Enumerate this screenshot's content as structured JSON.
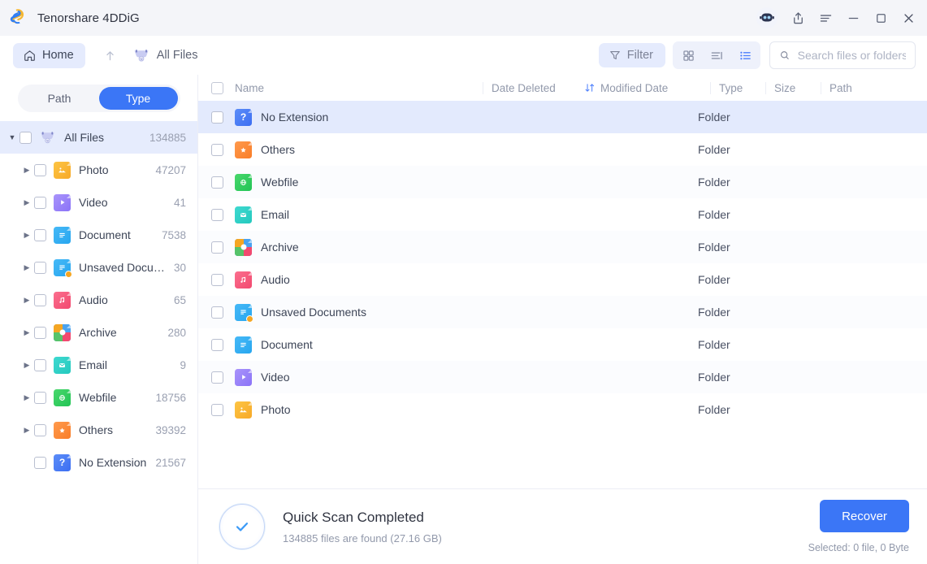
{
  "titlebar": {
    "app_name": "Tenorshare 4DDiG",
    "logo_icon": "4ddig-logo-icon",
    "buttons": [
      {
        "name": "ai-assistant-icon",
        "label": "AI"
      },
      {
        "name": "share-icon",
        "label": "Share"
      },
      {
        "name": "menu-icon",
        "label": "Menu"
      },
      {
        "name": "minimize-icon",
        "label": "Minimize"
      },
      {
        "name": "maximize-icon",
        "label": "Maximize"
      },
      {
        "name": "close-icon",
        "label": "Close"
      }
    ]
  },
  "toolbar": {
    "home_label": "Home",
    "home_icon": "home-icon",
    "up_icon": "arrow-up-icon",
    "breadcrumb_label": "All Files",
    "breadcrumb_icon": "all-files-icon",
    "filter_label": "Filter",
    "filter_icon": "funnel-icon",
    "view_grid_icon": "grid-view-icon",
    "view_detail_icon": "detail-view-icon",
    "view_list_icon": "list-view-icon",
    "active_view": "list",
    "search_icon": "search-icon",
    "search_value": "",
    "search_placeholder": "Search files or folders"
  },
  "sidebar": {
    "tabs": [
      {
        "label": "Path",
        "active": false
      },
      {
        "label": "Type",
        "active": true
      }
    ],
    "root": {
      "label": "All Files",
      "count": "134885",
      "icon": "all-files-icon",
      "selected": true
    },
    "items": [
      {
        "label": "Photo",
        "count": "47207",
        "icon": "photo-icon",
        "color": "#f9b game",
        "expandable": true
      },
      {
        "label": "Video",
        "count": "41",
        "icon": "video-icon",
        "expandable": true
      },
      {
        "label": "Document",
        "count": "7538",
        "icon": "document-icon",
        "expandable": true
      },
      {
        "label": "Unsaved Docum...",
        "count": "30",
        "icon": "unsaved-document-icon",
        "expandable": true
      },
      {
        "label": "Audio",
        "count": "65",
        "icon": "audio-icon",
        "expandable": true
      },
      {
        "label": "Archive",
        "count": "280",
        "icon": "archive-icon",
        "expandable": true
      },
      {
        "label": "Email",
        "count": "9",
        "icon": "email-icon",
        "expandable": true
      },
      {
        "label": "Webfile",
        "count": "18756",
        "icon": "webfile-icon",
        "expandable": true
      },
      {
        "label": "Others",
        "count": "39392",
        "icon": "others-icon",
        "expandable": true
      },
      {
        "label": "No Extension",
        "count": "21567",
        "icon": "no-extension-icon",
        "expandable": false
      }
    ]
  },
  "table": {
    "columns": [
      {
        "label": "Name",
        "key": "name"
      },
      {
        "label": "Date Deleted",
        "key": "date_deleted"
      },
      {
        "label": "Modified Date",
        "key": "modified_date",
        "sort_icon": "sort-icon"
      },
      {
        "label": "Type",
        "key": "type"
      },
      {
        "label": "Size",
        "key": "size"
      },
      {
        "label": "Path",
        "key": "path"
      }
    ],
    "rows": [
      {
        "name": "No Extension",
        "icon": "no-extension-icon",
        "date_deleted": "",
        "modified_date": "",
        "type": "Folder",
        "size": "",
        "path": "",
        "selected": true
      },
      {
        "name": "Others",
        "icon": "others-icon",
        "date_deleted": "",
        "modified_date": "",
        "type": "Folder",
        "size": "",
        "path": ""
      },
      {
        "name": "Webfile",
        "icon": "webfile-icon",
        "date_deleted": "",
        "modified_date": "",
        "type": "Folder",
        "size": "",
        "path": ""
      },
      {
        "name": "Email",
        "icon": "email-icon",
        "date_deleted": "",
        "modified_date": "",
        "type": "Folder",
        "size": "",
        "path": ""
      },
      {
        "name": "Archive",
        "icon": "archive-icon",
        "date_deleted": "",
        "modified_date": "",
        "type": "Folder",
        "size": "",
        "path": ""
      },
      {
        "name": "Audio",
        "icon": "audio-icon",
        "date_deleted": "",
        "modified_date": "",
        "type": "Folder",
        "size": "",
        "path": ""
      },
      {
        "name": "Unsaved Documents",
        "icon": "unsaved-document-icon",
        "date_deleted": "",
        "modified_date": "",
        "type": "Folder",
        "size": "",
        "path": ""
      },
      {
        "name": "Document",
        "icon": "document-icon",
        "date_deleted": "",
        "modified_date": "",
        "type": "Folder",
        "size": "",
        "path": ""
      },
      {
        "name": "Video",
        "icon": "video-icon",
        "date_deleted": "",
        "modified_date": "",
        "type": "Folder",
        "size": "",
        "path": ""
      },
      {
        "name": "Photo",
        "icon": "photo-icon",
        "date_deleted": "",
        "modified_date": "",
        "type": "Folder",
        "size": "",
        "path": ""
      }
    ]
  },
  "footer": {
    "status_icon": "check-circle-icon",
    "status_title": "Quick Scan Completed",
    "status_sub": "134885 files are found (27.16 GB)",
    "recover_label": "Recover",
    "selected_info": "Selected: 0 file, 0 Byte"
  },
  "colors": {
    "accent": "#3b76f6",
    "accent_soft": "#e5ebfd",
    "row_selected": "#e3eafd",
    "titlebar_bg": "#f4f5f9",
    "text": "#3d4557",
    "muted": "#9299ab"
  }
}
